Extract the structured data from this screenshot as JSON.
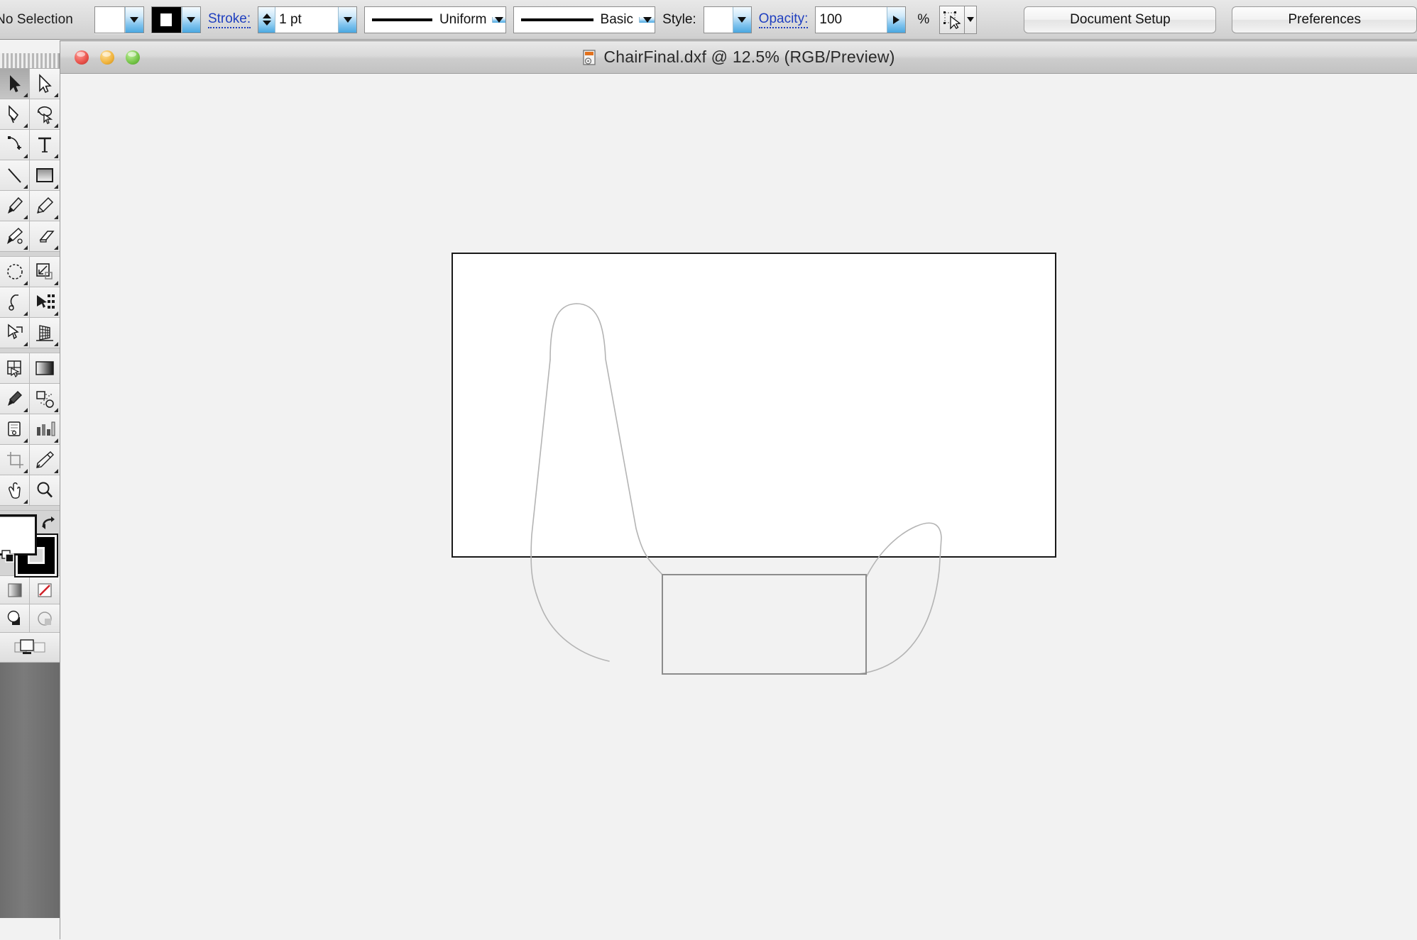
{
  "app": {
    "control_bar": {
      "selection_status": "No Selection",
      "fill_swatch": {
        "name": "fill-swatch",
        "color": "#ffffff"
      },
      "stroke_swatch": {
        "name": "stroke-swatch",
        "color": "#000000"
      },
      "stroke_label": "Stroke:",
      "stroke_weight": "1 pt",
      "stroke_profile": "Uniform",
      "brush_definition": "Basic",
      "style_label": "Style:",
      "style_swatch_color": "#ffffff",
      "opacity_label": "Opacity:",
      "opacity_value": "100",
      "percent_sign": "%",
      "transform_icon": "transform-each-icon",
      "document_setup_label": "Document Setup",
      "preferences_label": "Preferences"
    },
    "document_window": {
      "title": "ChairFinal.dxf @ 12.5% (RGB/Preview)",
      "file_name": "ChairFinal.dxf",
      "zoom_level": "12.5%",
      "color_mode": "RGB/Preview",
      "traffic_lights": [
        {
          "name": "close-button",
          "color": "#e8514a"
        },
        {
          "name": "minimize-button",
          "color": "#f0b33c"
        },
        {
          "name": "zoom-button",
          "color": "#74c447"
        }
      ],
      "canvas_background": "#f2f2f2",
      "artboard_background": "#ffffff",
      "artwork_stroke_color": "#b0b0b0"
    },
    "toolbox": {
      "tools": [
        {
          "name": "tool-direct-selection",
          "label": "Direct Selection Tool",
          "active": true,
          "icon": "direct-selection-arrow-icon"
        },
        {
          "name": "tool-selection",
          "label": "Selection Tool",
          "active": false,
          "icon": "selection-arrow-icon"
        },
        {
          "name": "tool-pen",
          "label": "Pen Tool",
          "active": false,
          "icon": "pen-icon"
        },
        {
          "name": "tool-lasso",
          "label": "Lasso Tool",
          "active": false,
          "icon": "lasso-icon"
        },
        {
          "name": "tool-add-anchor",
          "label": "Add Anchor Point Tool",
          "active": false,
          "icon": "add-anchor-point-icon"
        },
        {
          "name": "tool-type",
          "label": "Type Tool",
          "active": false,
          "icon": "type-t-icon"
        },
        {
          "name": "tool-line-segment",
          "label": "Line Segment Tool",
          "active": false,
          "icon": "line-segment-icon"
        },
        {
          "name": "tool-rectangle",
          "label": "Rectangle Tool",
          "active": false,
          "icon": "rectangle-icon"
        },
        {
          "name": "tool-paintbrush",
          "label": "Paintbrush Tool",
          "active": false,
          "icon": "paintbrush-icon"
        },
        {
          "name": "tool-pencil",
          "label": "Pencil Tool",
          "active": false,
          "icon": "pencil-icon"
        },
        {
          "name": "tool-blob-brush",
          "label": "Blob Brush Tool",
          "active": false,
          "icon": "blob-brush-icon"
        },
        {
          "name": "tool-eraser",
          "label": "Eraser Tool",
          "active": false,
          "icon": "eraser-icon"
        },
        {
          "name": "tool-rotate",
          "label": "Rotate Tool",
          "active": false,
          "icon": "rotate-icon"
        },
        {
          "name": "tool-scale",
          "label": "Scale Tool",
          "active": false,
          "icon": "scale-icon"
        },
        {
          "name": "tool-width",
          "label": "Width Tool",
          "active": false,
          "icon": "width-icon"
        },
        {
          "name": "tool-free-transform",
          "label": "Free Transform Tool",
          "active": false,
          "icon": "free-transform-icon"
        },
        {
          "name": "tool-shape-builder",
          "label": "Shape Builder Tool",
          "active": false,
          "icon": "shape-builder-icon"
        },
        {
          "name": "tool-perspective-grid",
          "label": "Perspective Grid Tool",
          "active": false,
          "icon": "perspective-grid-icon"
        },
        {
          "name": "tool-mesh",
          "label": "Mesh Tool",
          "active": false,
          "icon": "mesh-icon"
        },
        {
          "name": "tool-gradient",
          "label": "Gradient Tool",
          "active": false,
          "icon": "gradient-icon"
        },
        {
          "name": "tool-eyedropper-2",
          "label": "Eyedropper Tool",
          "active": false,
          "icon": "eyedropper-icon"
        },
        {
          "name": "tool-blend",
          "label": "Blend Tool",
          "active": false,
          "icon": "blend-icon"
        },
        {
          "name": "tool-symbol-sprayer",
          "label": "Symbol Sprayer Tool",
          "active": false,
          "icon": "symbol-sprayer-icon"
        },
        {
          "name": "tool-column-graph",
          "label": "Column Graph Tool",
          "active": false,
          "icon": "column-graph-icon"
        },
        {
          "name": "tool-artboard",
          "label": "Artboard Tool",
          "active": false,
          "icon": "artboard-icon"
        },
        {
          "name": "tool-slice",
          "label": "Slice Tool",
          "active": false,
          "icon": "slice-knife-icon"
        },
        {
          "name": "tool-hand",
          "label": "Hand Tool",
          "active": false,
          "icon": "hand-icon"
        },
        {
          "name": "tool-zoom",
          "label": "Zoom Tool",
          "active": false,
          "icon": "magnifier-icon"
        }
      ],
      "fill_color": "#ffffff",
      "stroke_color": "#000000",
      "swap_icon": "swap-fill-stroke-icon",
      "default_icon": "default-fill-stroke-icon",
      "modes": [
        {
          "name": "color-mode-gradient",
          "label": "Gradient",
          "icon": "gradient-square-icon"
        },
        {
          "name": "color-mode-none",
          "label": "None",
          "icon": "none-slash-icon"
        },
        {
          "name": "draw-mode-normal",
          "label": "Draw Normal",
          "icon": "draw-normal-icon"
        },
        {
          "name": "draw-mode-inside",
          "label": "Draw Inside",
          "icon": "draw-inside-icon"
        }
      ],
      "screen_mode": {
        "name": "screen-mode-button",
        "label": "Change Screen Mode",
        "icon": "screen-mode-icon"
      }
    }
  }
}
